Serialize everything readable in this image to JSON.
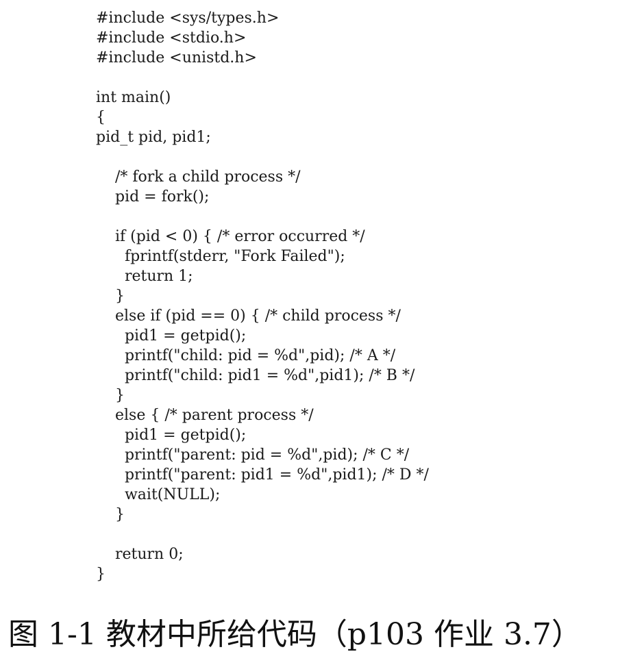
{
  "document": {
    "code_lines": [
      "#include <sys/types.h>",
      "#include <stdio.h>",
      "#include <unistd.h>",
      "",
      "int main()",
      "{",
      "pid_t pid, pid1;",
      "",
      "    /* fork a child process */",
      "    pid = fork();",
      "",
      "    if (pid < 0) { /* error occurred */",
      "      fprintf(stderr, \"Fork Failed\");",
      "      return 1;",
      "    }",
      "    else if (pid == 0) { /* child process */",
      "      pid1 = getpid();",
      "      printf(\"child: pid = %d\",pid); /* A */",
      "      printf(\"child: pid1 = %d\",pid1); /* B */",
      "    }",
      "    else { /* parent process */",
      "      pid1 = getpid();",
      "      printf(\"parent: pid = %d\",pid); /* C */",
      "      printf(\"parent: pid1 = %d\",pid1); /* D */",
      "      wait(NULL);",
      "    }",
      "",
      "    return 0;",
      "}"
    ],
    "caption": "图 1-1 教材中所给代码（p103 作业 3.7）"
  }
}
